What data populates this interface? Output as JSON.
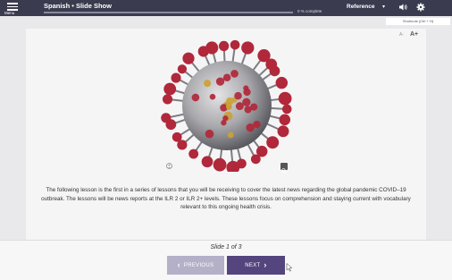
{
  "header": {
    "menu_label": "Menu",
    "title": "Spanish • Slide Show",
    "progress_text": "0 % complete",
    "progress": 0,
    "reference_label": "Reference"
  },
  "shortcuts_label": "Shortcuts (Ctrl + H)",
  "font_controls": {
    "small": "A-",
    "large": "A+"
  },
  "icons": {
    "menu": "hamburger-icon",
    "reference_dropdown": "chevron-down-icon",
    "volume": "speaker-icon",
    "settings": "gear-icon",
    "image_credit": "info-icon",
    "image_zoom": "zoom-icon"
  },
  "content": {
    "image_alt": "coronavirus illustration",
    "description": "The following lesson is the first in a series of lessons that you will be receiving to cover the latest news regarding the global pandemic COVID–19 outbreak. The lessons will be news reports at the ILR 2 or ILR 2+ levels. These lessons focus on comprehension and staying current with vocabulary relevant to this ongoing health crisis."
  },
  "footer": {
    "slide_counter": "Slide 1 of 3",
    "prev_label": "PREVIOUS",
    "next_label": "NEXT"
  },
  "colors": {
    "topbar": "#3b3b50",
    "next_button": "#54457e",
    "prev_button": "#b4b0c8",
    "virus_spike": "#b0283a"
  }
}
